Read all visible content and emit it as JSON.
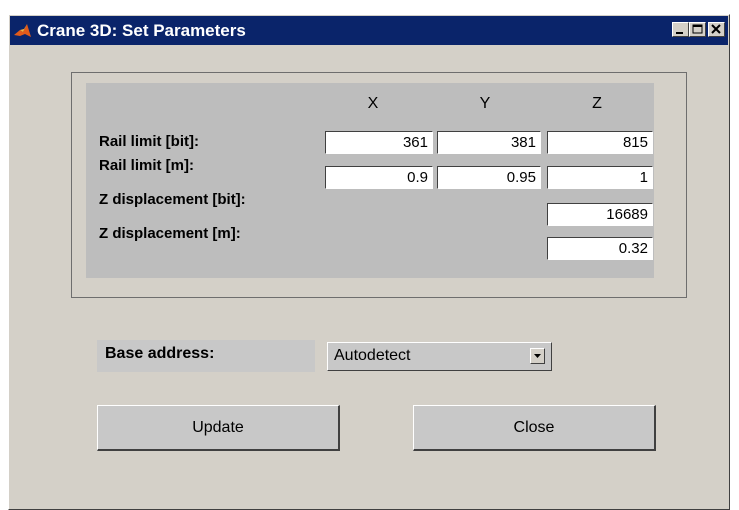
{
  "window": {
    "title": "Crane 3D: Set Parameters"
  },
  "grid": {
    "headers": [
      "X",
      "Y",
      "Z"
    ],
    "rows": [
      {
        "label": "Rail limit [bit]:",
        "values": [
          "361",
          "381",
          "815"
        ]
      },
      {
        "label": "Rail limit [m]:",
        "values": [
          "0.9",
          "0.95",
          "1"
        ]
      },
      {
        "label": "Z displacement [bit]:",
        "values": [
          "16689"
        ]
      },
      {
        "label": "Z displacement [m]:",
        "values": [
          "0.32"
        ]
      }
    ]
  },
  "base_address": {
    "label": "Base address:",
    "selected": "Autodetect"
  },
  "buttons": {
    "update": "Update",
    "close": "Close"
  },
  "icons": {
    "app": "matlab-logo-icon",
    "minimize": "minimize-icon",
    "maximize": "maximize-icon",
    "close": "close-icon",
    "dropdown": "chevron-down-icon"
  },
  "colors": {
    "titlebar": "#0a246a",
    "face": "#d4d0c8"
  }
}
